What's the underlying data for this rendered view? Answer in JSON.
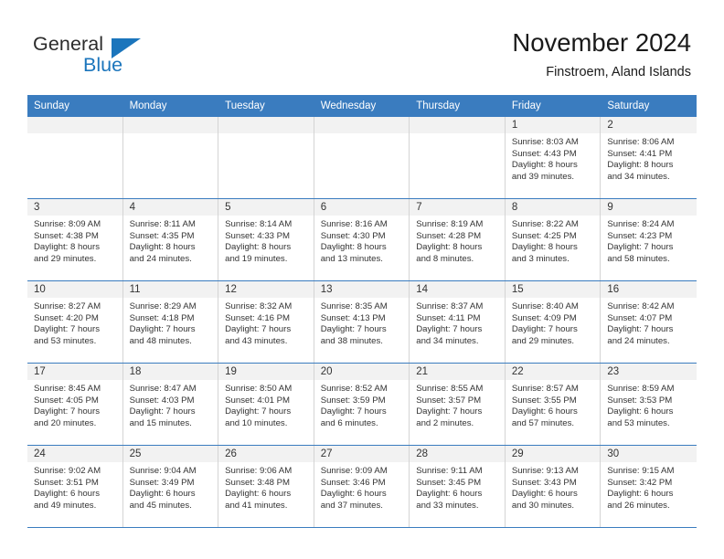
{
  "logo": {
    "word_top": "General",
    "word_bottom": "Blue",
    "accent_color": "#1b75bc"
  },
  "header": {
    "title": "November 2024",
    "subtitle": "Finstroem, Aland Islands"
  },
  "calendar": {
    "header_color": "#3a7cbf",
    "weekday_headers": [
      "Sunday",
      "Monday",
      "Tuesday",
      "Wednesday",
      "Thursday",
      "Friday",
      "Saturday"
    ],
    "weeks": [
      [
        {
          "day": "",
          "empty": true
        },
        {
          "day": "",
          "empty": true
        },
        {
          "day": "",
          "empty": true
        },
        {
          "day": "",
          "empty": true
        },
        {
          "day": "",
          "empty": true
        },
        {
          "day": "1",
          "sunrise": "Sunrise: 8:03 AM",
          "sunset": "Sunset: 4:43 PM",
          "daylight_1": "Daylight: 8 hours",
          "daylight_2": "and 39 minutes."
        },
        {
          "day": "2",
          "sunrise": "Sunrise: 8:06 AM",
          "sunset": "Sunset: 4:41 PM",
          "daylight_1": "Daylight: 8 hours",
          "daylight_2": "and 34 minutes."
        }
      ],
      [
        {
          "day": "3",
          "sunrise": "Sunrise: 8:09 AM",
          "sunset": "Sunset: 4:38 PM",
          "daylight_1": "Daylight: 8 hours",
          "daylight_2": "and 29 minutes."
        },
        {
          "day": "4",
          "sunrise": "Sunrise: 8:11 AM",
          "sunset": "Sunset: 4:35 PM",
          "daylight_1": "Daylight: 8 hours",
          "daylight_2": "and 24 minutes."
        },
        {
          "day": "5",
          "sunrise": "Sunrise: 8:14 AM",
          "sunset": "Sunset: 4:33 PM",
          "daylight_1": "Daylight: 8 hours",
          "daylight_2": "and 19 minutes."
        },
        {
          "day": "6",
          "sunrise": "Sunrise: 8:16 AM",
          "sunset": "Sunset: 4:30 PM",
          "daylight_1": "Daylight: 8 hours",
          "daylight_2": "and 13 minutes."
        },
        {
          "day": "7",
          "sunrise": "Sunrise: 8:19 AM",
          "sunset": "Sunset: 4:28 PM",
          "daylight_1": "Daylight: 8 hours",
          "daylight_2": "and 8 minutes."
        },
        {
          "day": "8",
          "sunrise": "Sunrise: 8:22 AM",
          "sunset": "Sunset: 4:25 PM",
          "daylight_1": "Daylight: 8 hours",
          "daylight_2": "and 3 minutes."
        },
        {
          "day": "9",
          "sunrise": "Sunrise: 8:24 AM",
          "sunset": "Sunset: 4:23 PM",
          "daylight_1": "Daylight: 7 hours",
          "daylight_2": "and 58 minutes."
        }
      ],
      [
        {
          "day": "10",
          "sunrise": "Sunrise: 8:27 AM",
          "sunset": "Sunset: 4:20 PM",
          "daylight_1": "Daylight: 7 hours",
          "daylight_2": "and 53 minutes."
        },
        {
          "day": "11",
          "sunrise": "Sunrise: 8:29 AM",
          "sunset": "Sunset: 4:18 PM",
          "daylight_1": "Daylight: 7 hours",
          "daylight_2": "and 48 minutes."
        },
        {
          "day": "12",
          "sunrise": "Sunrise: 8:32 AM",
          "sunset": "Sunset: 4:16 PM",
          "daylight_1": "Daylight: 7 hours",
          "daylight_2": "and 43 minutes."
        },
        {
          "day": "13",
          "sunrise": "Sunrise: 8:35 AM",
          "sunset": "Sunset: 4:13 PM",
          "daylight_1": "Daylight: 7 hours",
          "daylight_2": "and 38 minutes."
        },
        {
          "day": "14",
          "sunrise": "Sunrise: 8:37 AM",
          "sunset": "Sunset: 4:11 PM",
          "daylight_1": "Daylight: 7 hours",
          "daylight_2": "and 34 minutes."
        },
        {
          "day": "15",
          "sunrise": "Sunrise: 8:40 AM",
          "sunset": "Sunset: 4:09 PM",
          "daylight_1": "Daylight: 7 hours",
          "daylight_2": "and 29 minutes."
        },
        {
          "day": "16",
          "sunrise": "Sunrise: 8:42 AM",
          "sunset": "Sunset: 4:07 PM",
          "daylight_1": "Daylight: 7 hours",
          "daylight_2": "and 24 minutes."
        }
      ],
      [
        {
          "day": "17",
          "sunrise": "Sunrise: 8:45 AM",
          "sunset": "Sunset: 4:05 PM",
          "daylight_1": "Daylight: 7 hours",
          "daylight_2": "and 20 minutes."
        },
        {
          "day": "18",
          "sunrise": "Sunrise: 8:47 AM",
          "sunset": "Sunset: 4:03 PM",
          "daylight_1": "Daylight: 7 hours",
          "daylight_2": "and 15 minutes."
        },
        {
          "day": "19",
          "sunrise": "Sunrise: 8:50 AM",
          "sunset": "Sunset: 4:01 PM",
          "daylight_1": "Daylight: 7 hours",
          "daylight_2": "and 10 minutes."
        },
        {
          "day": "20",
          "sunrise": "Sunrise: 8:52 AM",
          "sunset": "Sunset: 3:59 PM",
          "daylight_1": "Daylight: 7 hours",
          "daylight_2": "and 6 minutes."
        },
        {
          "day": "21",
          "sunrise": "Sunrise: 8:55 AM",
          "sunset": "Sunset: 3:57 PM",
          "daylight_1": "Daylight: 7 hours",
          "daylight_2": "and 2 minutes."
        },
        {
          "day": "22",
          "sunrise": "Sunrise: 8:57 AM",
          "sunset": "Sunset: 3:55 PM",
          "daylight_1": "Daylight: 6 hours",
          "daylight_2": "and 57 minutes."
        },
        {
          "day": "23",
          "sunrise": "Sunrise: 8:59 AM",
          "sunset": "Sunset: 3:53 PM",
          "daylight_1": "Daylight: 6 hours",
          "daylight_2": "and 53 minutes."
        }
      ],
      [
        {
          "day": "24",
          "sunrise": "Sunrise: 9:02 AM",
          "sunset": "Sunset: 3:51 PM",
          "daylight_1": "Daylight: 6 hours",
          "daylight_2": "and 49 minutes."
        },
        {
          "day": "25",
          "sunrise": "Sunrise: 9:04 AM",
          "sunset": "Sunset: 3:49 PM",
          "daylight_1": "Daylight: 6 hours",
          "daylight_2": "and 45 minutes."
        },
        {
          "day": "26",
          "sunrise": "Sunrise: 9:06 AM",
          "sunset": "Sunset: 3:48 PM",
          "daylight_1": "Daylight: 6 hours",
          "daylight_2": "and 41 minutes."
        },
        {
          "day": "27",
          "sunrise": "Sunrise: 9:09 AM",
          "sunset": "Sunset: 3:46 PM",
          "daylight_1": "Daylight: 6 hours",
          "daylight_2": "and 37 minutes."
        },
        {
          "day": "28",
          "sunrise": "Sunrise: 9:11 AM",
          "sunset": "Sunset: 3:45 PM",
          "daylight_1": "Daylight: 6 hours",
          "daylight_2": "and 33 minutes."
        },
        {
          "day": "29",
          "sunrise": "Sunrise: 9:13 AM",
          "sunset": "Sunset: 3:43 PM",
          "daylight_1": "Daylight: 6 hours",
          "daylight_2": "and 30 minutes."
        },
        {
          "day": "30",
          "sunrise": "Sunrise: 9:15 AM",
          "sunset": "Sunset: 3:42 PM",
          "daylight_1": "Daylight: 6 hours",
          "daylight_2": "and 26 minutes."
        }
      ]
    ]
  }
}
